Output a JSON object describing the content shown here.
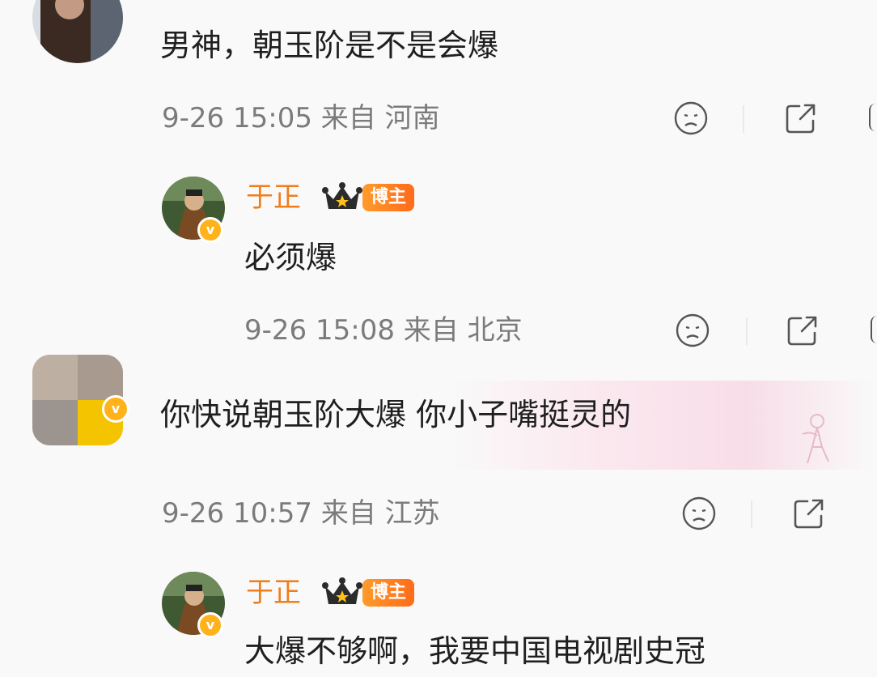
{
  "comments": [
    {
      "text": "男神，朝玉阶是不是会爆",
      "meta": "9-26 15:05 来自 河南"
    },
    {
      "author": "于正",
      "badge": "博主",
      "text": "必须爆",
      "meta": "9-26 15:08 来自 北京"
    },
    {
      "text": "你快说朝玉阶大爆 你小子嘴挺灵的",
      "meta": "9-26 10:57 来自 江苏"
    },
    {
      "author": "于正",
      "badge": "博主",
      "text": "大爆不够啊，我要中国电视剧史冠"
    }
  ],
  "icons": {
    "reaction": "sad-face-icon",
    "share": "share-icon",
    "crown": "crown-icon",
    "verified": "verified-badge-icon"
  },
  "colors": {
    "author_name": "#ef7d1a",
    "meta_text": "#7b7b7b",
    "badge_bg": "#ff7a20",
    "verified": "#ffb21a"
  }
}
